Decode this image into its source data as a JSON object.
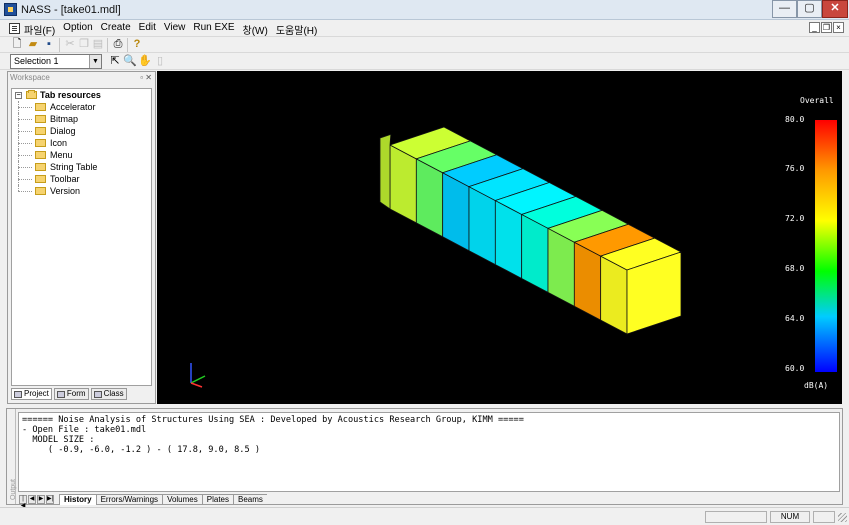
{
  "window": {
    "title": "NASS - [take01.mdl]"
  },
  "menubar": {
    "items": [
      "파일(F)",
      "Option",
      "Create",
      "Edit",
      "View",
      "Run EXE",
      "창(W)",
      "도움말(H)"
    ]
  },
  "toolbar": {
    "selection_value": "Selection 1"
  },
  "workspace": {
    "header": "Workspace",
    "tree": {
      "root": "Tab resources",
      "items": [
        "Accelerator",
        "Bitmap",
        "Dialog",
        "Icon",
        "Menu",
        "String Table",
        "Toolbar",
        "Version"
      ]
    },
    "tabs": [
      "Project",
      "Form",
      "Class"
    ]
  },
  "viewport": {
    "colorbar": {
      "title": "Overall",
      "unit": "dB(A)",
      "labels": [
        "80.0",
        "76.0",
        "72.0",
        "68.0",
        "64.0",
        "60.0"
      ],
      "stops": [
        "#ff0000",
        "#ff9900",
        "#ffff00",
        "#00ff00",
        "#00ccff",
        "#0000ff"
      ]
    },
    "model_segment_colors": [
      "#ccff33",
      "#66ff66",
      "#00ccff",
      "#00e5ff",
      "#00f5ff",
      "#00ffdd",
      "#88ff55",
      "#ff9900",
      "#ffff22"
    ]
  },
  "output": {
    "side_label": "Output",
    "lines": [
      "====== Noise Analysis of Structures Using SEA : Developed by Acoustics Research Group, KIMM =====",
      "- Open File : take01.mdl",
      "  MODEL SIZE :",
      "     ( -0.9, -6.0, -1.2 ) - ( 17.8, 9.0, 8.5 )"
    ],
    "tabs": [
      "History",
      "Errors/Warnings",
      "Volumes",
      "Plates",
      "Beams"
    ],
    "active_tab": "History"
  },
  "status": {
    "num": "NUM"
  }
}
